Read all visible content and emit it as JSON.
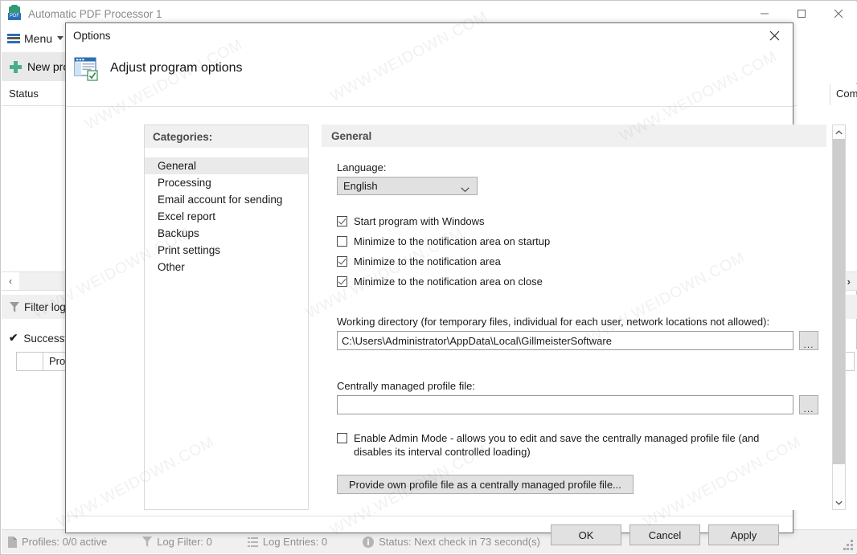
{
  "app": {
    "title": "Automatic PDF Processor 1",
    "icon": "pdf-gear-icon",
    "pdf_badge": "PDF"
  },
  "window_controls": {
    "minimize": "minimize-icon",
    "maximize": "maximize-icon",
    "close": "close-icon"
  },
  "menubar": {
    "menu_label": "Menu"
  },
  "toolbar": {
    "new_profile_label": "New prof"
  },
  "grid": {
    "status_column": "Status",
    "comment_column": "Com"
  },
  "log_area": {
    "filter_log_label": "Filter log",
    "successful_label": "Successfu",
    "processing_label": "Processi",
    "collapse_left": "‹",
    "expand_right": "›"
  },
  "statusbar": {
    "items": [
      {
        "icon": "profiles-icon",
        "label": "Profiles: 0/0 active"
      },
      {
        "icon": "filter-icon",
        "label": "Log Filter: 0"
      },
      {
        "icon": "list-icon",
        "label": "Log Entries: 0"
      },
      {
        "icon": "info-icon",
        "label": "Status: Next check in 73 second(s)"
      }
    ]
  },
  "dialog": {
    "title": "Options",
    "close_icon": "close-icon",
    "header_icon": "options-window-check-icon",
    "header_text": "Adjust program options",
    "categories": {
      "header": "Categories:",
      "items": [
        {
          "label": "General",
          "selected": true
        },
        {
          "label": "Processing",
          "selected": false
        },
        {
          "label": "Email account for sending",
          "selected": false
        },
        {
          "label": "Excel report",
          "selected": false
        },
        {
          "label": "Backups",
          "selected": false
        },
        {
          "label": "Print settings",
          "selected": false
        },
        {
          "label": "Other",
          "selected": false
        }
      ]
    },
    "general": {
      "header": "General",
      "language_label": "Language:",
      "language_value": "English",
      "checkboxes": [
        {
          "label": "Start program with Windows",
          "checked": true
        },
        {
          "label": "Minimize to the notification area on startup",
          "checked": false
        },
        {
          "label": "Minimize to the notification area",
          "checked": true
        },
        {
          "label": "Minimize to the notification area on close",
          "checked": true
        }
      ],
      "working_directory_label": "Working directory (for temporary files, individual for each user, network locations not allowed):",
      "working_directory_value": "C:\\Users\\Administrator\\AppData\\Local\\GillmeisterSoftware",
      "working_directory_browse": "...",
      "profile_file_label": "Centrally managed profile file:",
      "profile_file_value": "",
      "profile_file_placeholder": "",
      "profile_file_browse": "...",
      "admin_mode_label": "Enable Admin Mode - allows you to edit and save the centrally managed profile file (and disables its interval controlled loading)",
      "admin_mode_checked": false,
      "provide_profile_button": "Provide own profile file as a centrally managed profile file..."
    },
    "scrollbar": {
      "up_arrow": "chevron-up-icon",
      "down_arrow": "chevron-down-icon"
    },
    "buttons": {
      "ok": "OK",
      "cancel": "Cancel",
      "apply": "Apply"
    }
  },
  "watermarks": [
    "WWW.WEIDOWN.COM",
    "WWW.WEIDOWN.COM",
    "WWW.WEIDOWN.COM",
    "WWW.WEIDOWN.COM",
    "WWW.WEIDOWN.COM",
    "WWW.WEIDOWN.COM",
    "WWW.WEIDOWN.COM",
    "WWW.WEIDOWN.COM",
    "WWW.WEIDOWN.COM"
  ],
  "colors": {
    "accent_blue": "#2d6fb5",
    "accent_green": "#4aae8c",
    "success_green": "#17a07e",
    "panel_gray": "#f0f0f0",
    "button_face": "#e1e1e1"
  }
}
